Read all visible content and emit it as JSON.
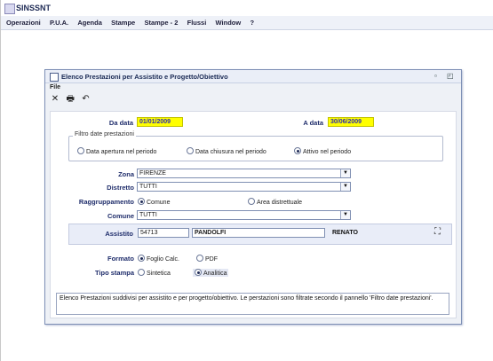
{
  "app": {
    "title": "SINSSNT"
  },
  "menubar": {
    "items": [
      "Operazioni",
      "P.U.A.",
      "Agenda",
      "Stampe",
      "Stampe - 2",
      "Flussi",
      "Window",
      "?"
    ]
  },
  "window": {
    "title": "Elenco Prestazioni per Assistito e Progetto/Obiettivo",
    "file_menu": "File",
    "controls": {
      "restore": "▫",
      "maximize": "◰"
    }
  },
  "toolbar": {
    "close_icon": "✕",
    "print_icon": "🖶",
    "undo_icon": "↶"
  },
  "form": {
    "da_data_label": "Da data",
    "da_data_value": "01/01/2009",
    "a_data_label": "A data",
    "a_data_value": "30/06/2009",
    "filter_group_label": "Filtro date prestazioni",
    "filter_options": [
      {
        "label": "Data apertura nel periodo",
        "selected": false
      },
      {
        "label": "Data chiusura nel periodo",
        "selected": false
      },
      {
        "label": "Attivo nel periodo",
        "selected": true
      }
    ],
    "zona_label": "Zona",
    "zona_value": "FIRENZE",
    "distretto_label": "Distretto",
    "distretto_value": "TUTTI",
    "raggruppamento_label": "Raggruppamento",
    "raggruppamento_options": [
      {
        "label": "Comune",
        "selected": true
      },
      {
        "label": "Area distrettuale",
        "selected": false
      }
    ],
    "comune_label": "Comune",
    "comune_value": "TUTTI",
    "assistito_label": "Assistito",
    "assistito_code": "54713",
    "assistito_cognome": "PANDOLFI",
    "assistito_nome": "RENATO",
    "formato_label": "Formato",
    "formato_options": [
      {
        "label": "Foglio Calc.",
        "selected": true
      },
      {
        "label": "PDF",
        "selected": false
      }
    ],
    "tipo_stampa_label": "Tipo stampa",
    "tipo_stampa_options": [
      {
        "label": "Sintetica",
        "selected": false
      },
      {
        "label": "Analitica",
        "selected": true
      }
    ],
    "note": "Elenco Prestazioni suddivisi per assistito e per progetto/obiettivo. Le perstazioni sono filtrate secondo il pannello 'Filtro date prestazioni'."
  }
}
